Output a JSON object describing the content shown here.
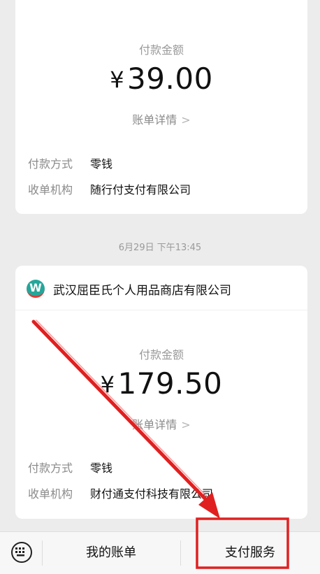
{
  "card1": {
    "amount_label": "付款金额",
    "currency": "¥",
    "amount": "39.00",
    "detail_link": "账单详情",
    "rows": [
      {
        "key": "付款方式",
        "value": "零钱"
      },
      {
        "key": "收单机构",
        "value": "随行付支付有限公司"
      }
    ]
  },
  "date_label": "6月29日 下午13:45",
  "card2": {
    "merchant_logo_letter": "W",
    "merchant_name": "武汉屈臣氏个人用品商店有限公司",
    "amount_label": "付款金额",
    "currency": "¥",
    "amount": "179.50",
    "detail_link": "账单详情",
    "rows": [
      {
        "key": "付款方式",
        "value": "零钱"
      },
      {
        "key": "收单机构",
        "value": "财付通支付科技有限公司"
      }
    ]
  },
  "bottom_bar": {
    "keyboard_icon": "keyboard-icon",
    "tabs": [
      {
        "label": "我的账单"
      },
      {
        "label": "支付服务"
      }
    ]
  },
  "colors": {
    "annotation_red": "#e02020",
    "logo_teal": "#26a69a"
  }
}
